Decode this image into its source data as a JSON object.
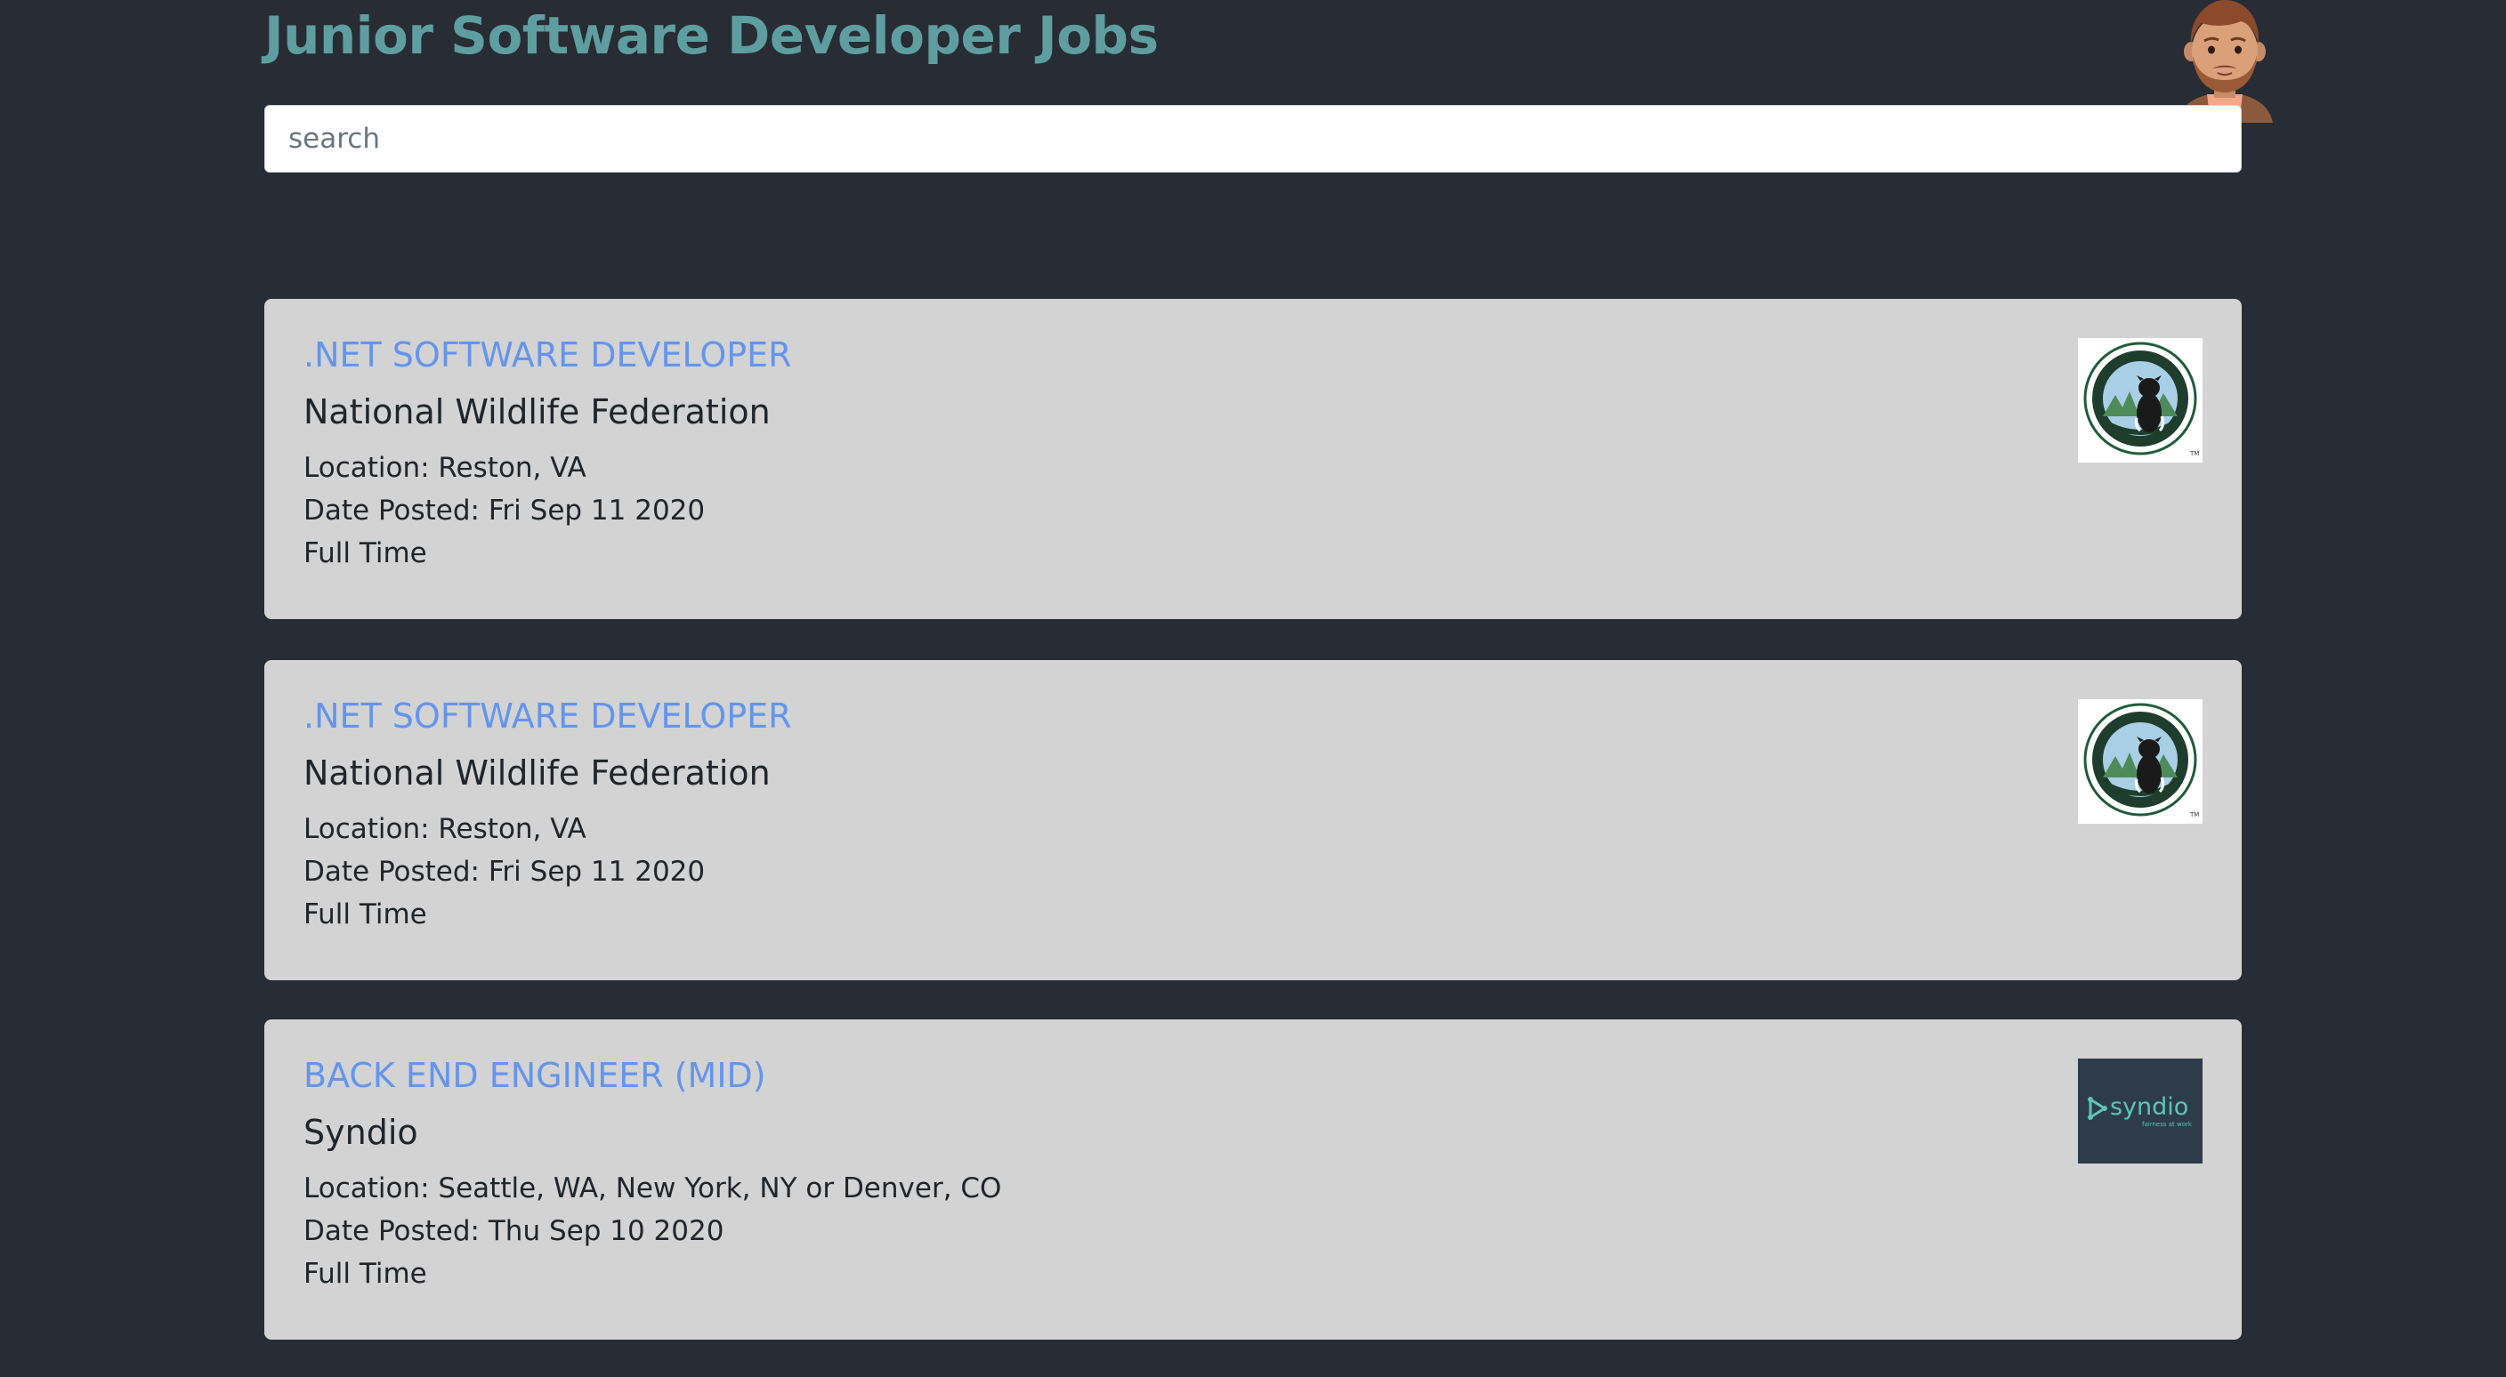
{
  "header": {
    "title": "Junior Software Developer Jobs"
  },
  "search": {
    "placeholder": "search",
    "value": ""
  },
  "jobs": [
    {
      "title": ".NET SOFTWARE DEVELOPER",
      "company": "National Wildlife Federation",
      "location": "Location: Reston, VA",
      "date_posted": "Date Posted: Fri Sep 11 2020",
      "type": "Full Time",
      "logo": {
        "icon": "national-wildlife-federation-logo",
        "top_text": "NATIONAL WILDLIFE FEDERATION",
        "bottom_text": "SINCE 1936",
        "mark": "TM"
      }
    },
    {
      "title": ".NET SOFTWARE DEVELOPER",
      "company": "National Wildlife Federation",
      "location": "Location: Reston, VA",
      "date_posted": "Date Posted: Fri Sep 11 2020",
      "type": "Full Time",
      "logo": {
        "icon": "national-wildlife-federation-logo",
        "top_text": "NATIONAL WILDLIFE FEDERATION",
        "bottom_text": "SINCE 1936",
        "mark": "TM"
      }
    },
    {
      "title": "BACK END ENGINEER (MID)",
      "company": "Syndio",
      "location": "Location: Seattle, WA, New York, NY or Denver, CO",
      "date_posted": "Date Posted: Thu Sep 10 2020",
      "type": "Full Time",
      "logo": {
        "icon": "syndio-logo",
        "wordmark": "syndio",
        "tagline": "fairness at work"
      }
    }
  ],
  "colors": {
    "background": "#282c34",
    "title": "#5f9ea0",
    "card": "#d3d3d3",
    "job_link": "#6495ed",
    "text": "#212529"
  },
  "icons": {
    "avatar": "developer-avatar-icon"
  }
}
